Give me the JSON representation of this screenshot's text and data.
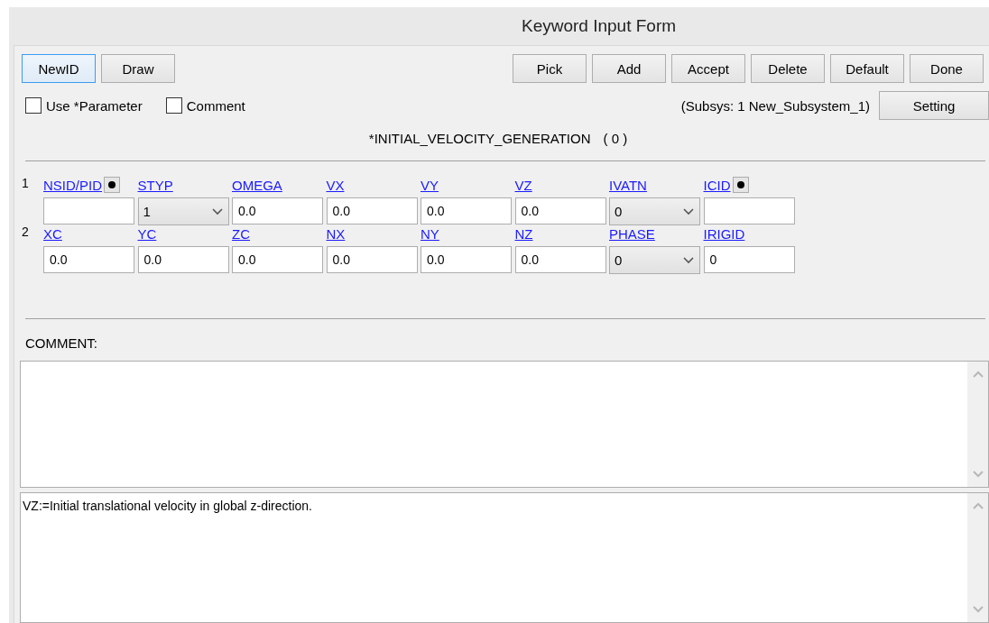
{
  "window": {
    "title": "Keyword Input Form"
  },
  "toolbar_left": [
    {
      "label": "NewID",
      "focused": true
    },
    {
      "label": "Draw",
      "focused": false
    }
  ],
  "toolbar_right": [
    "Pick",
    "Add",
    "Accept",
    "Delete",
    "Default",
    "Done"
  ],
  "options": [
    {
      "label": "Use *Parameter",
      "checked": false
    },
    {
      "label": "Comment",
      "checked": false
    }
  ],
  "subsystem": "(Subsys: 1 New_Subsystem_1)",
  "setting_button": "Setting",
  "keyword": "*INITIAL_VELOCITY_GENERATION",
  "count": "( 0 )",
  "cards": [
    {
      "number": "1",
      "fields": [
        {
          "label": "NSID/PID",
          "kind": "text",
          "pick": true
        },
        {
          "label": "STYP",
          "kind": "select",
          "value": "1",
          "pick": false
        },
        {
          "label": "OMEGA",
          "kind": "text",
          "value": "0.0",
          "pick": false
        },
        {
          "label": "VX",
          "kind": "text",
          "value": "0.0",
          "pick": false
        },
        {
          "label": "VY",
          "kind": "text",
          "value": "0.0",
          "pick": false
        },
        {
          "label": "VZ",
          "kind": "text",
          "value": "0.0",
          "pick": false
        },
        {
          "label": "IVATN",
          "kind": "select",
          "value": "0",
          "pick": false
        },
        {
          "label": "ICID",
          "kind": "text",
          "pick": true
        }
      ]
    },
    {
      "number": "2",
      "fields": [
        {
          "label": "XC",
          "kind": "text",
          "value": "0.0",
          "pick": false
        },
        {
          "label": "YC",
          "kind": "text",
          "value": "0.0",
          "pick": false
        },
        {
          "label": "ZC",
          "kind": "text",
          "value": "0.0",
          "pick": false
        },
        {
          "label": "NX",
          "kind": "text",
          "value": "0.0",
          "pick": false
        },
        {
          "label": "NY",
          "kind": "text",
          "value": "0.0",
          "pick": false
        },
        {
          "label": "NZ",
          "kind": "text",
          "value": "0.0",
          "pick": false
        },
        {
          "label": "PHASE",
          "kind": "select",
          "value": "0",
          "pick": false
        },
        {
          "label": "IRIGID",
          "kind": "text",
          "value": "0",
          "pick": false
        }
      ]
    }
  ],
  "comment_label": "COMMENT:",
  "help_text": "VZ:=Initial translational velocity in global z-direction."
}
